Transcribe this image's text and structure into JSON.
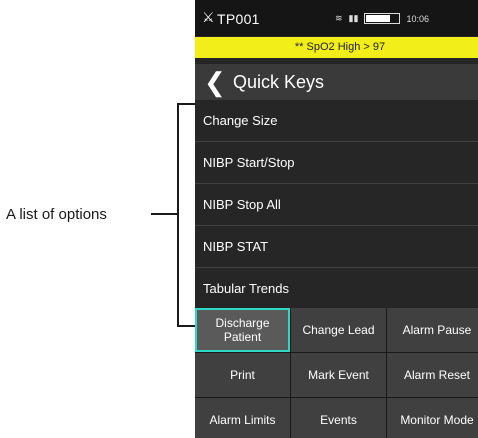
{
  "annotation": {
    "label": "A list of options"
  },
  "status_bar": {
    "patient_id": "TP001",
    "clock": "10:06"
  },
  "alarm_bar": {
    "text": "** SpO2 High > 97",
    "color": "#f2ee1a"
  },
  "title_bar": {
    "title": "Quick Keys"
  },
  "options": [
    {
      "label": "Change Size"
    },
    {
      "label": "NIBP Start/Stop"
    },
    {
      "label": "NIBP Stop All"
    },
    {
      "label": "NIBP STAT"
    },
    {
      "label": "Tabular Trends"
    }
  ],
  "quick_keys": [
    {
      "label": "Discharge Patient",
      "selected": true
    },
    {
      "label": "Change Lead"
    },
    {
      "label": "Alarm Pause"
    },
    {
      "label": "Print"
    },
    {
      "label": "Mark Event"
    },
    {
      "label": "Alarm Reset"
    },
    {
      "label": "Alarm Limits"
    },
    {
      "label": "Events"
    },
    {
      "label": "Monitor Mode"
    }
  ],
  "colors": {
    "screen_bg": "#262626",
    "key_bg": "#404040",
    "selected_border": "#2fd8c4"
  }
}
